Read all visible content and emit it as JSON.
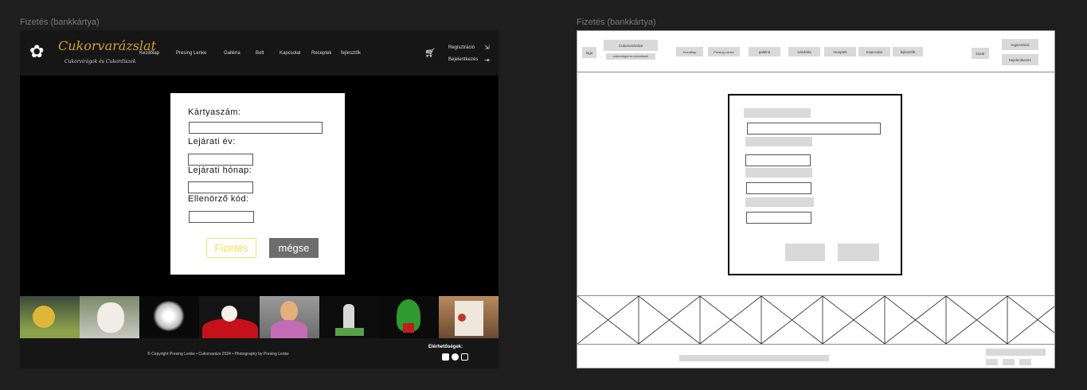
{
  "frame_left_title": "Fizetés (bankkártya)",
  "frame_right_title": "Fizetés (bankkártya)",
  "design": {
    "brand": "Cukorvarázslat",
    "brand_sub": "Cukorvirágok és Cukordíszek",
    "nav": [
      "Kezdőlap",
      "Presing Lenke",
      "Galléria",
      "Bolt",
      "Kapcsolat",
      "Receptek",
      "fejlesztők"
    ],
    "register": "Regisztráció",
    "login": "Bejelentkezés",
    "form": {
      "card_number_label": "Kártyaszám:",
      "expiry_year_label": "Lejárati év:",
      "expiry_month_label": "Lejárati hónap:",
      "cvc_label": "Ellenörző kód:",
      "pay_button": "Fizetés",
      "cancel_button": "mégse"
    },
    "copyright": "© Copyright Presing Lenke • Cukorvarázs 2024 • Photography by Presing Lenke",
    "contact_label": "Elérhetőségek:",
    "photos": [
      "bee-baby",
      "white-dog",
      "white-flowers",
      "red-dog-cake",
      "doll-cake",
      "bunny-cake",
      "green-dragon",
      "floral-cake"
    ]
  },
  "wireframe": {
    "logo": "logo",
    "brand": "Cukorvarázslat",
    "brand_sub": "cukorvirágok és cukordíszek",
    "nav": [
      "Kezdőlap",
      "Presing Lenke",
      "galléria",
      "Vásárlás",
      "receptek",
      "Kapcsolat",
      "fejlesztők"
    ],
    "cart": "kosár",
    "register": "regisztráció",
    "login": "bejelentkezés"
  },
  "colors": {
    "brand_gold": "#d4a32e",
    "pay_yellow": "#f2e14a",
    "cancel_gray": "#6d6d6d"
  }
}
